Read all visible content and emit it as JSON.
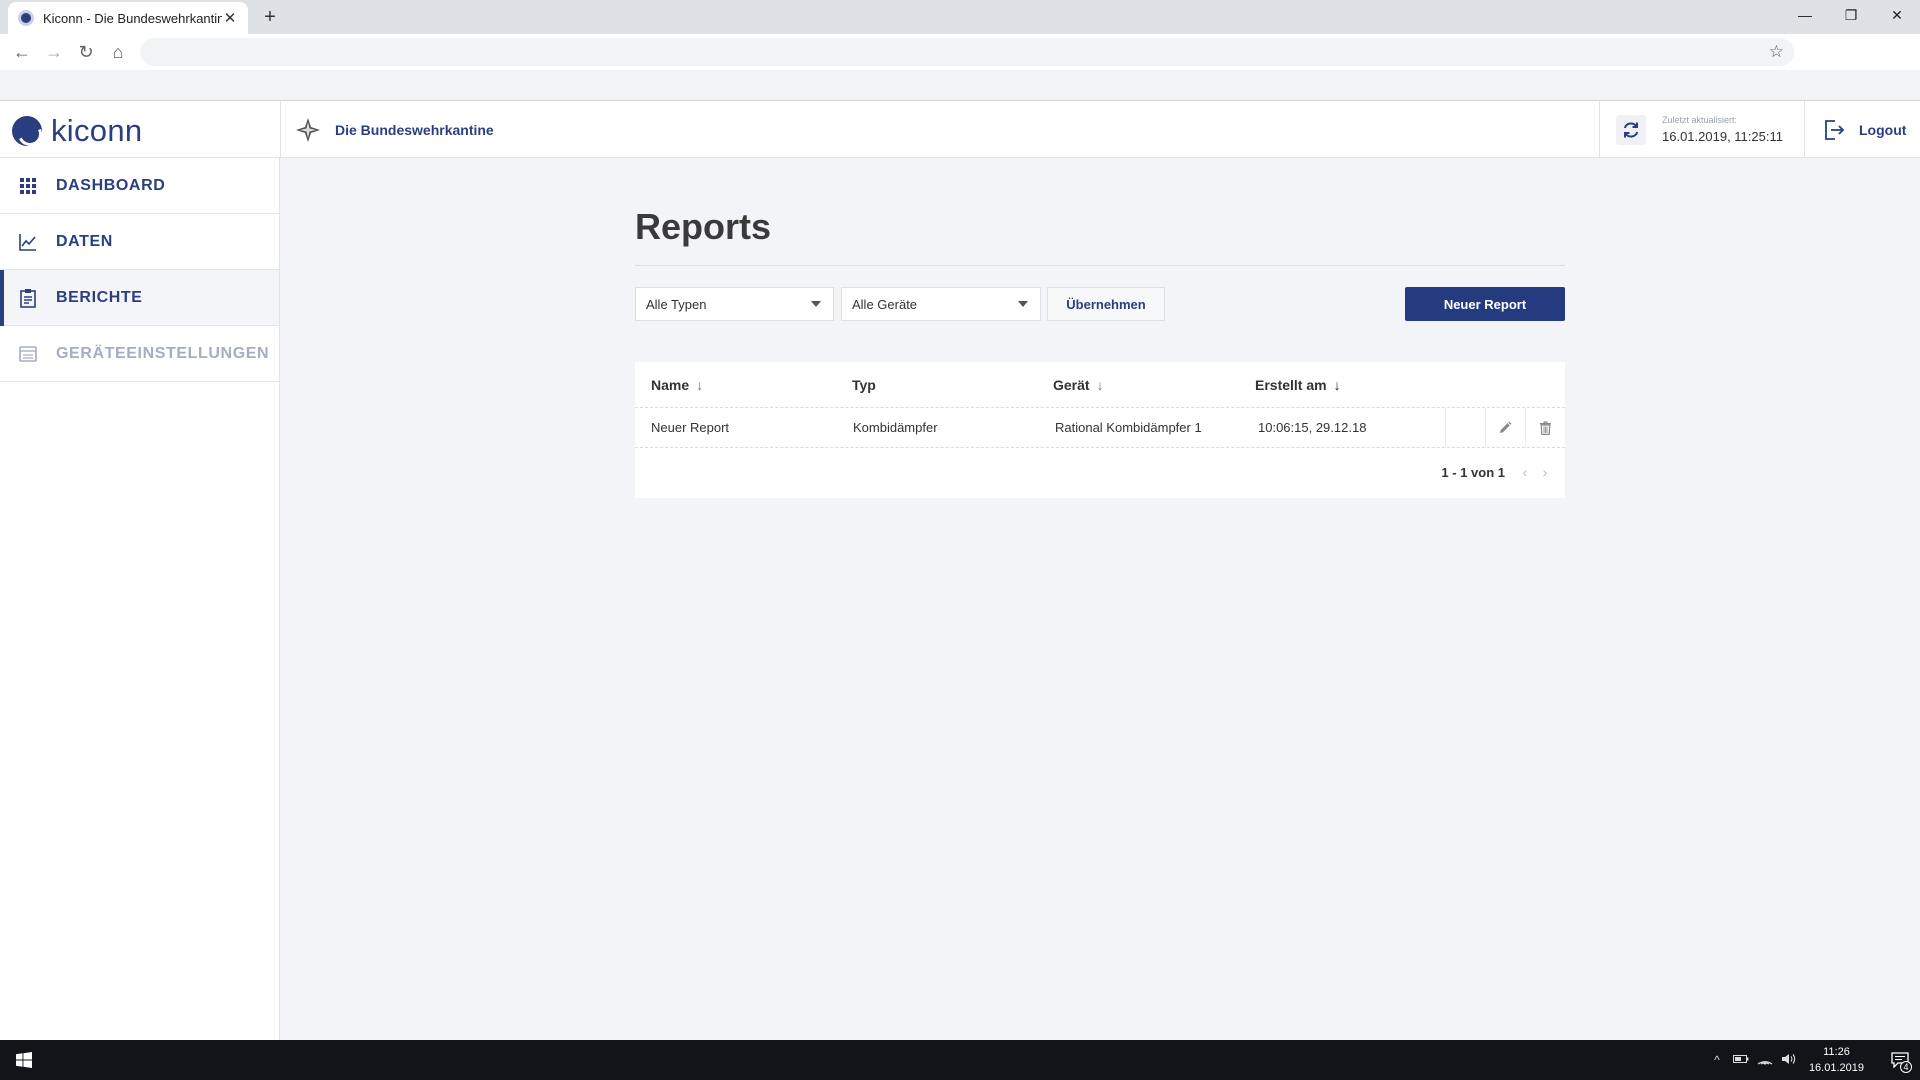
{
  "browser": {
    "tab_title": "Kiconn - Die Bundeswehrkantine",
    "tab_close": "✕",
    "new_tab": "+",
    "back": "←",
    "forward": "→",
    "reload": "↻",
    "home": "⌂",
    "star": "☆",
    "minimize": "—",
    "maximize": "❐",
    "close": "✕"
  },
  "header": {
    "logo": "kiconn",
    "organization": "Die Bundeswehrkantine",
    "updated_label": "Zuletzt aktualisiert:",
    "updated_time": "16.01.2019, 11:25:11",
    "logout": "Logout"
  },
  "sidebar": {
    "items": [
      {
        "label": "DASHBOARD",
        "icon": "grid-icon"
      },
      {
        "label": "DATEN",
        "icon": "chart-line-icon"
      },
      {
        "label": "BERICHTE",
        "icon": "clipboard-icon",
        "active": true
      },
      {
        "label": "GERÄTEEINSTELLUNGEN",
        "icon": "device-settings-icon",
        "disabled": true
      }
    ]
  },
  "main": {
    "title": "Reports",
    "filter_type": "Alle Typen",
    "filter_device": "Alle Geräte",
    "apply_label": "Übernehmen",
    "new_report_label": "Neuer Report",
    "table": {
      "columns": [
        {
          "label": "Name",
          "sort": "↓"
        },
        {
          "label": "Typ",
          "sort": ""
        },
        {
          "label": "Gerät",
          "sort": "↓"
        },
        {
          "label": "Erstellt am",
          "sort": "↓"
        }
      ],
      "rows": [
        {
          "name": "Neuer Report",
          "type": "Kombidämpfer",
          "device": "Rational Kombidämpfer 1",
          "created": "10:06:15, 29.12.18"
        }
      ],
      "pagination": "1 - 1 von 1",
      "prev": "‹",
      "next": "›"
    }
  },
  "taskbar": {
    "time": "11:26",
    "date": "16.01.2019",
    "tray_chevron": "^",
    "notifications": "4"
  },
  "colors": {
    "brand": "#2b3f80",
    "primary_button": "#243b80",
    "background": "#f3f4f7"
  }
}
